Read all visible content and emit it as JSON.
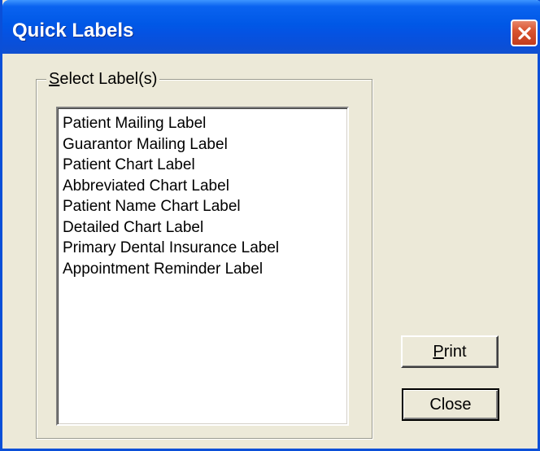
{
  "window": {
    "title": "Quick Labels"
  },
  "group": {
    "legend_mnemonic": "S",
    "legend_rest": "elect Label(s)"
  },
  "labels": [
    "Patient Mailing Label",
    "Guarantor Mailing Label",
    "Patient Chart Label",
    "Abbreviated Chart Label",
    "Patient Name Chart Label",
    "Detailed Chart Label",
    "Primary Dental Insurance Label",
    "Appointment Reminder Label"
  ],
  "buttons": {
    "print_mnemonic": "P",
    "print_rest": "rint",
    "close_label": "Close"
  },
  "icons": {
    "close": "close-icon"
  },
  "colors": {
    "titlebar": "#0058e6",
    "close_button": "#d9542f",
    "dialog_face": "#ece9d8"
  }
}
